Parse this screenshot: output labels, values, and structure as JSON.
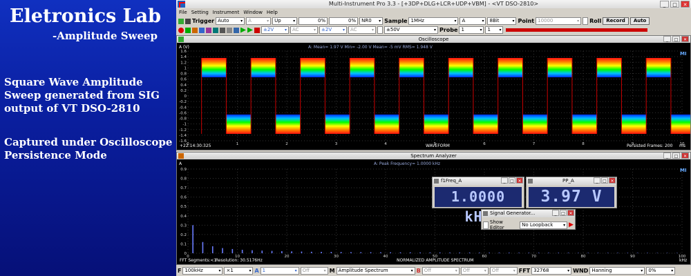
{
  "slide": {
    "title": "Eletronics Lab",
    "subtitle": "-Amplitude Sweep",
    "para1": "Square Wave Amplitude Sweep generated from SIG output of VT DSO-2810",
    "para2": "Captured under Oscilloscope Persistence Mode"
  },
  "window": {
    "title": "Multi-Instrument Pro 3.3   -   [+3DP+DLG+LCR+UDP+VBM]   -   <VT DSO-2810>",
    "menu": [
      "File",
      "Setting",
      "Instrument",
      "Window",
      "Help"
    ]
  },
  "toolbar1": {
    "trigger_label": "Trigger",
    "trigger_mode": "Auto",
    "trigger_channel": "A",
    "trigger_edge": "Up",
    "trigger_level": "0%",
    "trigger_delay": "0%",
    "ref_channel": "NR0",
    "sample_label": "Sample",
    "sample_rate": "1MHz",
    "sample_channel": "A",
    "bits": "8Bit",
    "point_label": "Point",
    "point_value": "10000",
    "roll_label": "Roll",
    "record_label": "Record",
    "auto_label": "Auto"
  },
  "toolbar2": {
    "range_a": "±2V",
    "coupling_a": "AC",
    "range_b": "±50V",
    "probe_label": "Probe",
    "probe_a": "1",
    "probe_b": "1"
  },
  "oscilloscope": {
    "title": "Oscilloscope",
    "yunit": "A (V)",
    "readout": "A: Mean=   1.97   V    Min=   -2.00   V  Mean=      -5  mV  RMS=    1.948  V",
    "yticks": [
      "1.6",
      "1.4",
      "1.2",
      "1",
      "0.8",
      "0.6",
      "0.4",
      "0.2",
      "0",
      "-0.2",
      "-0.4",
      "-0.6",
      "-0.8",
      "-1",
      "-1.2",
      "-1.4",
      "-1.6"
    ],
    "xticks": [
      "0",
      "1",
      "2",
      "3",
      "4",
      "5",
      "6",
      "7",
      "8",
      "9",
      "10"
    ],
    "xunit": "ms",
    "timestamp": "+22:14:30:325",
    "xlabel": "WAVEFORM",
    "persisted": "Persisted Frames: 200",
    "mark": "MI"
  },
  "spectrum": {
    "title": "Spectrum Analyzer",
    "yunit": "A",
    "readout": "A: Peak Frequency=   1.0000  kHz",
    "yticks": [
      "0.9",
      "0.8",
      "0.7",
      "0.6",
      "0.5",
      "0.4",
      "0.3",
      "0.2",
      "0.1",
      "0"
    ],
    "xticks": [
      "0",
      "10",
      "20",
      "30",
      "40",
      "50",
      "60",
      "70",
      "80",
      "90",
      "100"
    ],
    "xunit": "kHz",
    "footer_left": "FFT Segments:<1",
    "resolution": "Resolution: 30.5176Hz",
    "xlabel": "NORMALIZED AMPLITUDE SPECTRUM",
    "mark": "MI",
    "peaks": [
      0.3,
      0.12,
      0.075,
      0.055,
      0.045,
      0.037,
      0.032,
      0.028,
      0.025,
      0.022,
      0.02,
      0.018,
      0.016,
      0.015,
      0.014,
      0.013,
      0.012,
      0.011,
      0.011,
      0.01,
      0.01,
      0.009,
      0.009,
      0.008,
      0.008,
      0.008,
      0.007,
      0.007,
      0.007,
      0.006,
      0.006,
      0.006,
      0.006,
      0.005,
      0.005,
      0.005,
      0.005,
      0.005,
      0.005,
      0.004,
      0.004,
      0.004,
      0.004,
      0.004,
      0.004,
      0.004,
      0.004,
      0.003,
      0.003,
      0.003
    ]
  },
  "float_freq": {
    "title": "f1Freq_A",
    "value": "1.0000 kHz"
  },
  "float_pp": {
    "title": "PP_A",
    "value": "3.97 V"
  },
  "siggen": {
    "title": "Signal Generator...",
    "show_editor": "Show Editor",
    "loopback": "No Loopback"
  },
  "statusbar": {
    "f_label": "F",
    "f_value": "100kHz",
    "mult": "×1",
    "a_label": "A",
    "a_value": "1",
    "off1": "Off",
    "m_label": "M",
    "mode": "Amplitude Spectrum",
    "b_label": "B",
    "off2": "Off",
    "off3": "Off",
    "off4": "Off",
    "fft_label": "FFT",
    "fft_value": "32768",
    "wnd_label": "WND",
    "window": "Hanning",
    "pct": "0%"
  }
}
